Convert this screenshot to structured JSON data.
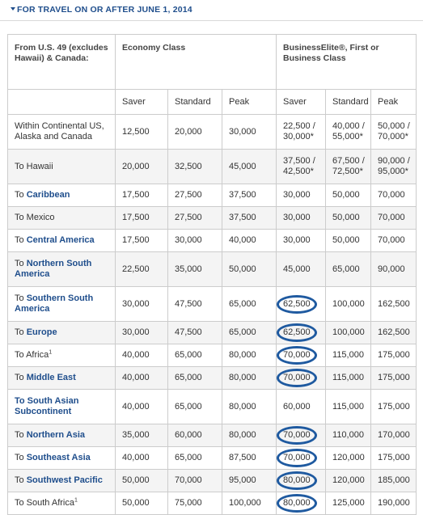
{
  "section": {
    "title": "FOR TRAVEL ON OR AFTER JUNE 1, 2014"
  },
  "table": {
    "corner_header": "From U.S. 49 (excludes Hawaii) & Canada:",
    "group_headers": {
      "economy": "Economy Class",
      "business": "BusinessElite®, First or Business Class"
    },
    "sub_headers": [
      "Saver",
      "Standard",
      "Peak",
      "Saver",
      "Standard",
      "Peak"
    ],
    "rows": [
      {
        "prefix": "Within Continental US, Alaska and Canada",
        "place": "",
        "sup": "",
        "eco_saver": "12,500",
        "eco_standard": "20,000",
        "eco_peak": "30,000",
        "bus_saver": "22,500 / 30,000*",
        "bus_standard": "40,000 / 55,000*",
        "bus_peak": "50,000 / 70,000*",
        "circled": false
      },
      {
        "prefix": "To Hawaii",
        "place": "",
        "sup": "",
        "eco_saver": "20,000",
        "eco_standard": "32,500",
        "eco_peak": "45,000",
        "bus_saver": "37,500 / 42,500*",
        "bus_standard": "67,500 / 72,500*",
        "bus_peak": "90,000 / 95,000*",
        "circled": false
      },
      {
        "prefix": "To ",
        "place": "Caribbean",
        "sup": "",
        "eco_saver": "17,500",
        "eco_standard": "27,500",
        "eco_peak": "37,500",
        "bus_saver": "30,000",
        "bus_standard": "50,000",
        "bus_peak": "70,000",
        "circled": false
      },
      {
        "prefix": "To Mexico",
        "place": "",
        "sup": "",
        "eco_saver": "17,500",
        "eco_standard": "27,500",
        "eco_peak": "37,500",
        "bus_saver": "30,000",
        "bus_standard": "50,000",
        "bus_peak": "70,000",
        "circled": false
      },
      {
        "prefix": "To ",
        "place": "Central America",
        "sup": "",
        "eco_saver": "17,500",
        "eco_standard": "30,000",
        "eco_peak": "40,000",
        "bus_saver": "30,000",
        "bus_standard": "50,000",
        "bus_peak": "70,000",
        "circled": false
      },
      {
        "prefix": "To ",
        "place": "Northern South America",
        "sup": "",
        "eco_saver": "22,500",
        "eco_standard": "35,000",
        "eco_peak": "50,000",
        "bus_saver": "45,000",
        "bus_standard": "65,000",
        "bus_peak": "90,000",
        "circled": false
      },
      {
        "prefix": "To ",
        "place": "Southern South America",
        "sup": "",
        "eco_saver": "30,000",
        "eco_standard": "47,500",
        "eco_peak": "65,000",
        "bus_saver": "62,500",
        "bus_standard": "100,000",
        "bus_peak": "162,500",
        "circled": true
      },
      {
        "prefix": "To ",
        "place": "Europe",
        "sup": "",
        "eco_saver": "30,000",
        "eco_standard": "47,500",
        "eco_peak": "65,000",
        "bus_saver": "62,500",
        "bus_standard": "100,000",
        "bus_peak": "162,500",
        "circled": true
      },
      {
        "prefix": "To Africa",
        "place": "",
        "sup": "1",
        "eco_saver": "40,000",
        "eco_standard": "65,000",
        "eco_peak": "80,000",
        "bus_saver": "70,000",
        "bus_standard": "115,000",
        "bus_peak": "175,000",
        "circled": true
      },
      {
        "prefix": "To ",
        "place": "Middle East",
        "sup": "",
        "eco_saver": "40,000",
        "eco_standard": "65,000",
        "eco_peak": "80,000",
        "bus_saver": "70,000",
        "bus_standard": "115,000",
        "bus_peak": "175,000",
        "circled": true
      },
      {
        "prefix": "",
        "place": "To South Asian Subcontinent",
        "sup": "",
        "eco_saver": "40,000",
        "eco_standard": "65,000",
        "eco_peak": "80,000",
        "bus_saver": "60,000",
        "bus_standard": "115,000",
        "bus_peak": "175,000",
        "circled": false
      },
      {
        "prefix": "To ",
        "place": "Northern Asia",
        "sup": "",
        "eco_saver": "35,000",
        "eco_standard": "60,000",
        "eco_peak": "80,000",
        "bus_saver": "70,000",
        "bus_standard": "110,000",
        "bus_peak": "170,000",
        "circled": true
      },
      {
        "prefix": "To ",
        "place": "Southeast Asia",
        "sup": "",
        "eco_saver": "40,000",
        "eco_standard": "65,000",
        "eco_peak": "87,500",
        "bus_saver": "70,000",
        "bus_standard": "120,000",
        "bus_peak": "175,000",
        "circled": true
      },
      {
        "prefix": "To ",
        "place": "Southwest Pacific",
        "sup": "",
        "eco_saver": "50,000",
        "eco_standard": "70,000",
        "eco_peak": "95,000",
        "bus_saver": "80,000",
        "bus_standard": "120,000",
        "bus_peak": "185,000",
        "circled": true
      },
      {
        "prefix": "To South Africa",
        "place": "",
        "sup": "1",
        "eco_saver": "50,000",
        "eco_standard": "75,000",
        "eco_peak": "100,000",
        "bus_saver": "80,000",
        "bus_standard": "125,000",
        "bus_peak": "190,000",
        "circled": true
      }
    ]
  },
  "colors": {
    "link": "#1f4e8c",
    "circle": "#1f5aa0",
    "border": "#cccccc",
    "shade": "#f4f4f4"
  }
}
